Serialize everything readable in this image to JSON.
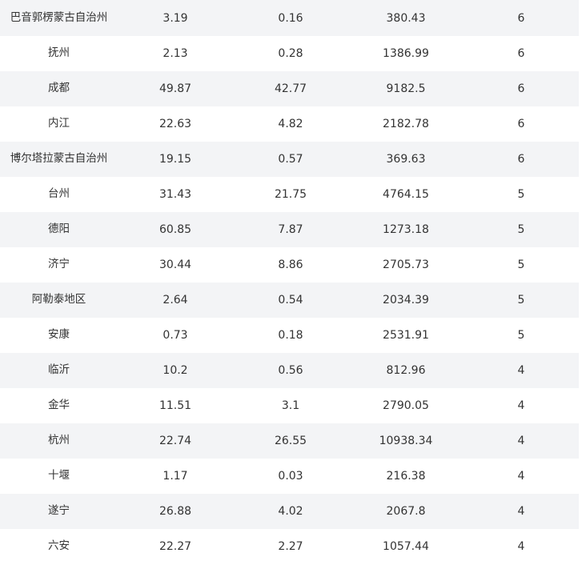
{
  "table": {
    "rows": [
      {
        "city": "巴音郭楞蒙古自治州",
        "v1": "3.19",
        "v2": "0.16",
        "v3": "380.43",
        "v4": "6"
      },
      {
        "city": "抚州",
        "v1": "2.13",
        "v2": "0.28",
        "v3": "1386.99",
        "v4": "6"
      },
      {
        "city": "成都",
        "v1": "49.87",
        "v2": "42.77",
        "v3": "9182.5",
        "v4": "6"
      },
      {
        "city": "内江",
        "v1": "22.63",
        "v2": "4.82",
        "v3": "2182.78",
        "v4": "6"
      },
      {
        "city": "博尔塔拉蒙古自治州",
        "v1": "19.15",
        "v2": "0.57",
        "v3": "369.63",
        "v4": "6"
      },
      {
        "city": "台州",
        "v1": "31.43",
        "v2": "21.75",
        "v3": "4764.15",
        "v4": "5"
      },
      {
        "city": "德阳",
        "v1": "60.85",
        "v2": "7.87",
        "v3": "1273.18",
        "v4": "5"
      },
      {
        "city": "济宁",
        "v1": "30.44",
        "v2": "8.86",
        "v3": "2705.73",
        "v4": "5"
      },
      {
        "city": "阿勒泰地区",
        "v1": "2.64",
        "v2": "0.54",
        "v3": "2034.39",
        "v4": "5"
      },
      {
        "city": "安康",
        "v1": "0.73",
        "v2": "0.18",
        "v3": "2531.91",
        "v4": "5"
      },
      {
        "city": "临沂",
        "v1": "10.2",
        "v2": "0.56",
        "v3": "812.96",
        "v4": "4"
      },
      {
        "city": "金华",
        "v1": "11.51",
        "v2": "3.1",
        "v3": "2790.05",
        "v4": "4"
      },
      {
        "city": "杭州",
        "v1": "22.74",
        "v2": "26.55",
        "v3": "10938.34",
        "v4": "4"
      },
      {
        "city": "十堰",
        "v1": "1.17",
        "v2": "0.03",
        "v3": "216.38",
        "v4": "4"
      },
      {
        "city": "遂宁",
        "v1": "26.88",
        "v2": "4.02",
        "v3": "2067.8",
        "v4": "4"
      },
      {
        "city": "六安",
        "v1": "22.27",
        "v2": "2.27",
        "v3": "1057.44",
        "v4": "4"
      }
    ]
  }
}
